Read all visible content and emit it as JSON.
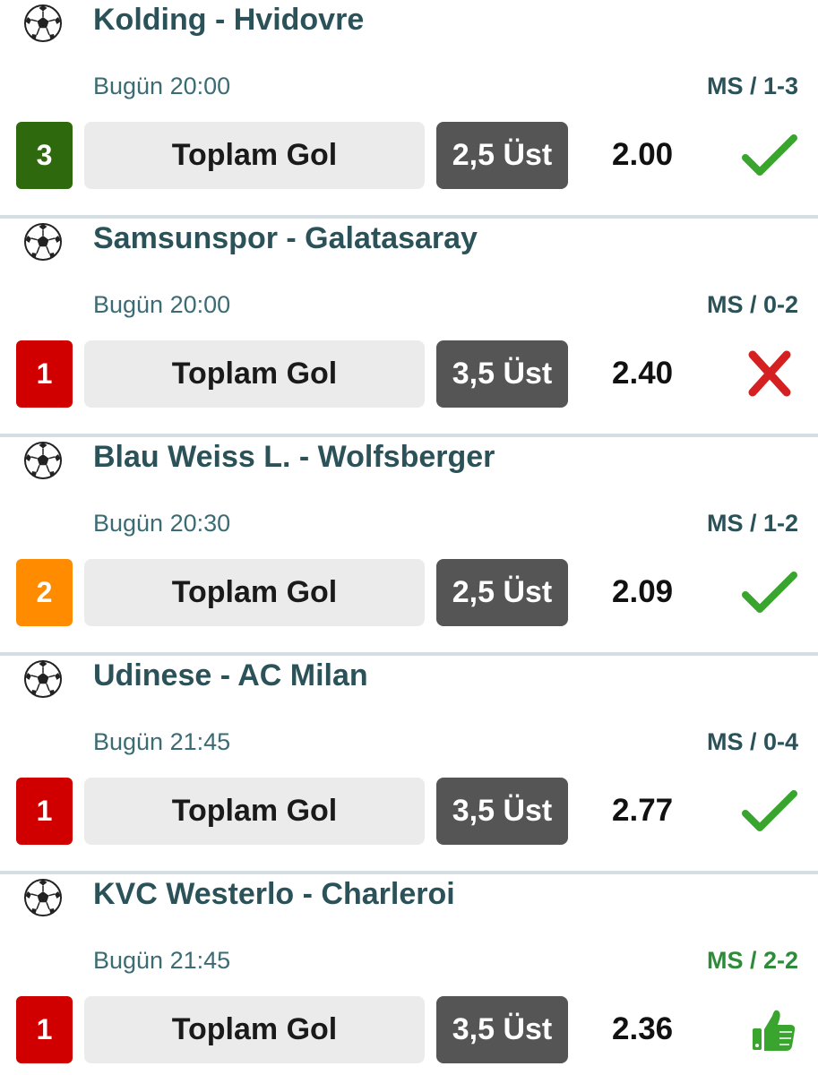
{
  "matches": [
    {
      "teams": "Kolding - Hvidovre",
      "time": "Bugün 20:00",
      "score": "MS / 1-3",
      "rank": "3",
      "market": "Toplam Gol",
      "pick": "2,5 Üst",
      "odds": "2.00",
      "result": "check-icon"
    },
    {
      "teams": "Samsunspor - Galatasaray",
      "time": "Bugün 20:00",
      "score": "MS / 0-2",
      "rank": "1",
      "market": "Toplam Gol",
      "pick": "3,5 Üst",
      "odds": "2.40",
      "result": "cross-icon"
    },
    {
      "teams": "Blau Weiss L. - Wolfsberger",
      "time": "Bugün 20:30",
      "score": "MS / 1-2",
      "rank": "2",
      "market": "Toplam Gol",
      "pick": "2,5 Üst",
      "odds": "2.09",
      "result": "check-icon"
    },
    {
      "teams": "Udinese - AC Milan",
      "time": "Bugün 21:45",
      "score": "MS / 0-4",
      "rank": "1",
      "market": "Toplam Gol",
      "pick": "3,5 Üst",
      "odds": "2.77",
      "result": "check-icon"
    },
    {
      "teams": "KVC Westerlo - Charleroi",
      "time": "Bugün 21:45",
      "score": "MS / 2-2",
      "rank": "1",
      "market": "Toplam Gol",
      "pick": "3,5 Üst",
      "odds": "2.36",
      "result": "thumbs-up-icon"
    }
  ],
  "colors": {
    "rank_1": "#d00000",
    "rank_2": "#ff8c00",
    "rank_3": "#2e6a0d",
    "score_default": "#2b5258",
    "score_live": "#2e8b3a",
    "check": "#3aa52e",
    "cross": "#d42020",
    "thumb": "#3aa52e"
  },
  "icons": {
    "sport": "soccer-ball-icon"
  }
}
